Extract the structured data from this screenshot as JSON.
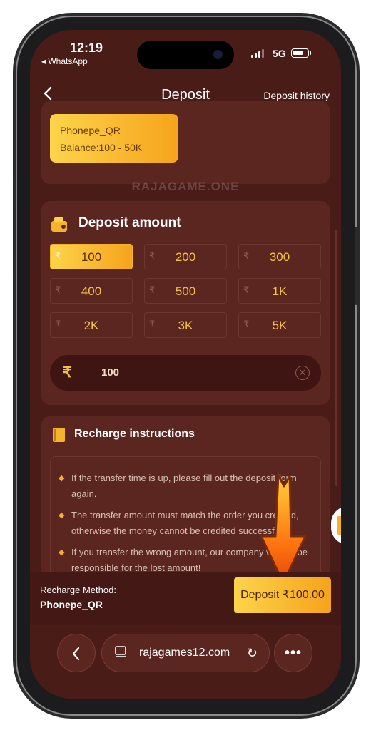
{
  "status": {
    "time": "12:19",
    "back_app": "◂ WhatsApp",
    "network": "5G"
  },
  "header": {
    "back_icon": "chevron-left-icon",
    "title": "Deposit",
    "history_link": "Deposit history"
  },
  "payment_method": {
    "name": "Phonepe_QR",
    "balance": "Balance:100 - 50K"
  },
  "watermark": "RAJAGAME.ONE",
  "deposit_amount": {
    "title": "Deposit amount",
    "currency_symbol": "₹",
    "options": [
      "100",
      "200",
      "300",
      "400",
      "500",
      "1K",
      "2K",
      "3K",
      "5K"
    ],
    "selected": "100",
    "input_value": "100"
  },
  "instructions": {
    "title": "Recharge instructions",
    "items": [
      "If the transfer time is up, please fill out the deposit form again.",
      "The transfer amount must match the order you created, otherwise the money cannot be credited successfully.",
      "If you transfer the wrong amount, our company will not be responsible for the lost amount!"
    ]
  },
  "footer": {
    "method_label": "Recharge Method:",
    "method_value": "Phonepe_QR",
    "deposit_button": "Deposit ₹100.00"
  },
  "browser": {
    "url": "rajagames12.com",
    "back_icon": "chevron-left-icon",
    "reload_icon": "reload-icon",
    "more_icon": "more-icon"
  },
  "colors": {
    "background": "#4a1c17",
    "card": "#5b2520",
    "accent": "#f6a31c",
    "gold_text": "#f2c14a"
  }
}
